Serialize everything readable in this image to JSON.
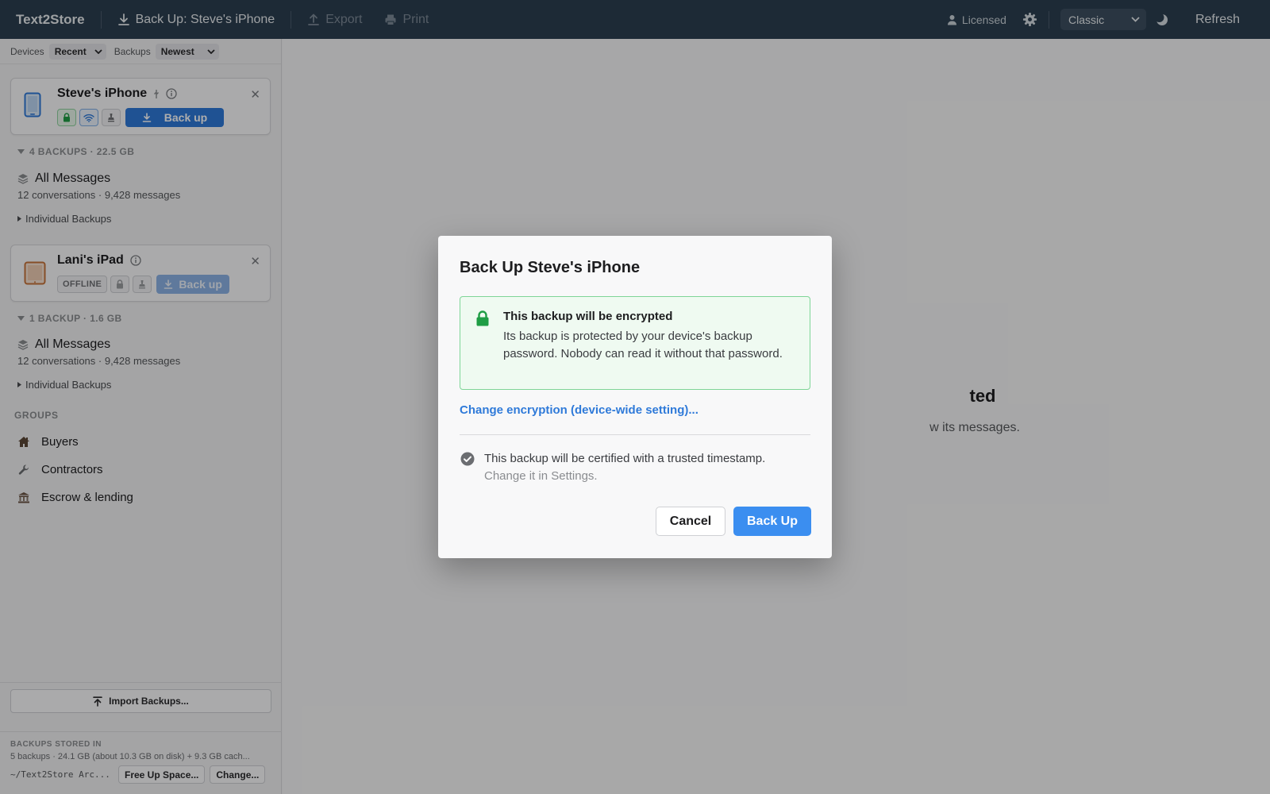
{
  "app": {
    "title": "Text2Store"
  },
  "toolbar": {
    "backup_label": "Back Up: Steve's iPhone",
    "export_label": "Export",
    "print_label": "Print",
    "licensed_label": "Licensed",
    "theme_value": "Classic",
    "refresh_label": "Refresh"
  },
  "sidebar": {
    "devices_label": "Devices",
    "devices_sort": "Recent",
    "backups_label": "Backups",
    "backups_sort": "Newest",
    "devices": [
      {
        "name": "Steve's iPhone",
        "backup_label": "Back up",
        "summary": "4 BACKUPS · 22.5 GB",
        "all_messages": "All Messages",
        "stats": "12 conversations · 9,428 messages",
        "individual": "Individual Backups"
      },
      {
        "name": "Lani's iPad",
        "status": "OFFLINE",
        "backup_label": "Back up",
        "summary": "1 BACKUP · 1.6 GB",
        "all_messages": "All Messages",
        "stats": "12 conversations · 9,428 messages",
        "individual": "Individual Backups"
      }
    ],
    "groups_heading": "GROUPS",
    "groups": [
      {
        "label": "Buyers",
        "icon": "house-icon"
      },
      {
        "label": "Contractors",
        "icon": "wrench-icon"
      },
      {
        "label": "Escrow & lending",
        "icon": "bank-icon"
      }
    ],
    "import_label": "Import Backups...",
    "storage_heading": "BACKUPS STORED IN",
    "storage_summary": "5 backups · 24.1 GB (about 10.3 GB on disk) + 9.3 GB cach...",
    "storage_path": "~/Text2Store Arc...",
    "free_space_label": "Free Up Space...",
    "change_label": "Change..."
  },
  "main": {
    "empty_title": "ted",
    "empty_sub": "w its messages."
  },
  "modal": {
    "title": "Back Up Steve's iPhone",
    "enc_heading": "This backup will be encrypted",
    "enc_body": "Its backup is protected by your device's backup password. Nobody can read it without that password.",
    "enc_link": "Change encryption (device-wide setting)...",
    "cert_text": "This backup will be certified with a trusted timestamp.",
    "cert_sub": "Change it in Settings.",
    "cancel_label": "Cancel",
    "backup_label": "Back Up"
  },
  "colors": {
    "topbar": "#2c3e50",
    "accent": "#2f7ad9",
    "success": "#1f9d45"
  }
}
